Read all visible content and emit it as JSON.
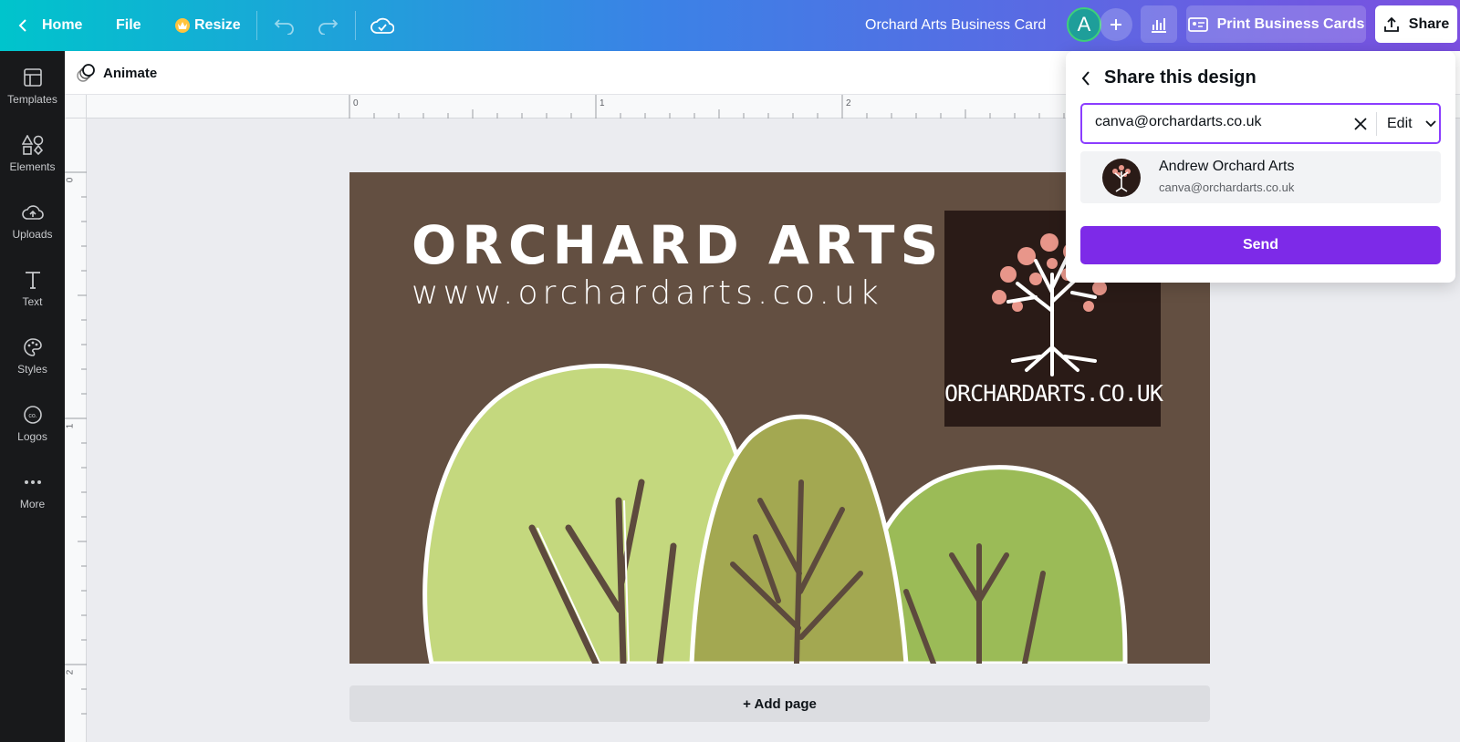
{
  "topbar": {
    "home_label": "Home",
    "file_label": "File",
    "resize_label": "Resize",
    "design_title": "Orchard Arts Business Card",
    "avatar_initial": "A",
    "print_label": "Print Business Cards",
    "share_label": "Share"
  },
  "sidebar": {
    "items": [
      {
        "label": "Templates",
        "icon": "templates-icon"
      },
      {
        "label": "Elements",
        "icon": "elements-icon"
      },
      {
        "label": "Uploads",
        "icon": "uploads-icon"
      },
      {
        "label": "Text",
        "icon": "text-icon"
      },
      {
        "label": "Styles",
        "icon": "styles-icon"
      },
      {
        "label": "Logos",
        "icon": "logos-icon"
      },
      {
        "label": "More",
        "icon": "more-icon"
      }
    ]
  },
  "subbar": {
    "animate_label": "Animate"
  },
  "rulers": {
    "top_numbers": [
      "0",
      "1",
      "2"
    ],
    "left_numbers": [
      "0",
      "1",
      "2"
    ]
  },
  "card": {
    "title": "ORCHARD ARTS",
    "url": "www.orchardarts.co.uk",
    "logo_text": "ORCHARDARTS.CO.UK"
  },
  "add_page_label": "+ Add page",
  "share_panel": {
    "title": "Share this design",
    "input_value": "canva@orchardarts.co.uk",
    "permission": "Edit",
    "suggestion": {
      "name": "Andrew Orchard Arts",
      "email": "canva@orchardarts.co.uk"
    },
    "send_label": "Send"
  },
  "colors": {
    "card_bg": "#634f41",
    "accent_purple": "#7d2ae8",
    "sidebar_bg": "#18191b"
  }
}
